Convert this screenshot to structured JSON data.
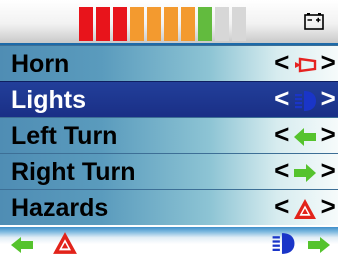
{
  "status_bar": {
    "battery_level_fraction": 0.67,
    "segments": [
      "#e8141b",
      "#e8141b",
      "#e8141b",
      "#f39a2f",
      "#f39a2f",
      "#f39a2f",
      "#f39a2f",
      "#62bb3e",
      "#d7d7d7",
      "#d7d7d7"
    ],
    "battery_icon": "battery-icon"
  },
  "menu": {
    "items": [
      {
        "label": "Horn",
        "icon": "horn-icon",
        "left_arrow": "<",
        "right_arrow": ">",
        "selected": false
      },
      {
        "label": "Lights",
        "icon": "headlight-icon",
        "left_arrow": "<",
        "right_arrow": ">",
        "selected": true
      },
      {
        "label": "Left Turn",
        "icon": "arrow-left-icon",
        "left_arrow": "<",
        "right_arrow": ">",
        "selected": false
      },
      {
        "label": "Right Turn",
        "icon": "arrow-right-icon",
        "left_arrow": "<",
        "right_arrow": ">",
        "selected": false
      },
      {
        "label": "Hazards",
        "icon": "hazard-icon",
        "left_arrow": "<",
        "right_arrow": ">",
        "selected": false
      }
    ]
  },
  "bottom_bar": {
    "icons": [
      "left-turn-indicator-icon",
      "hazard-indicator-icon",
      "headlight-indicator-icon",
      "right-turn-indicator-icon"
    ]
  },
  "colors": {
    "selected_row": "#1f3a96",
    "turn_arrow_green": "#55c32d",
    "hazard_red": "#e2231a",
    "horn_red": "#e52321",
    "headlight_blue": "#1a35c8"
  }
}
